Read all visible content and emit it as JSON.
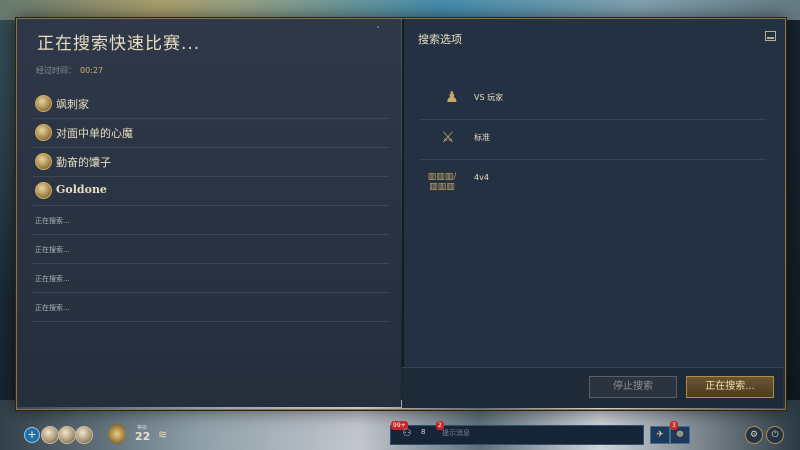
{
  "dialog": {
    "title": "正在搜索快速比赛...",
    "corner_mark": "ˋ",
    "elapsed_label": "经过时间：",
    "elapsed_time": "00:27"
  },
  "players": [
    {
      "name": "飒刺家",
      "bold": false
    },
    {
      "name": "对面中单的心魔",
      "bold": false
    },
    {
      "name": "勤奋的馕子",
      "bold": false
    },
    {
      "name": "Goldone",
      "bold": true
    }
  ],
  "searching_slots": [
    "正在搜索...",
    "正在搜索...",
    "正在搜索...",
    "正在搜索..."
  ],
  "options": {
    "title": "搜索选项",
    "items": [
      {
        "icon": "players-vs-icon",
        "glyph": "♟",
        "label": "VS 玩家"
      },
      {
        "icon": "standard-mode-icon",
        "glyph": "⚔",
        "label": "标准"
      },
      {
        "icon": "team-size-icon",
        "glyph": "▥▥▥/▥▥▥",
        "label": "4v4"
      }
    ]
  },
  "buttons": {
    "stop": "停止搜索",
    "searching": "正在搜索..."
  },
  "bottom_bar": {
    "plus": "+",
    "level_label": "等级",
    "level_value": "22",
    "chat_badge": "99+",
    "chat_people_count": "8",
    "chat_badge_2": "2",
    "chat_placeholder": "提示消息",
    "right_badge": "3"
  },
  "colors": {
    "accent_gold": "#b08c48",
    "panel_left": "#2e3848",
    "panel_right": "#243142",
    "text_cream": "#e6dcc0"
  }
}
